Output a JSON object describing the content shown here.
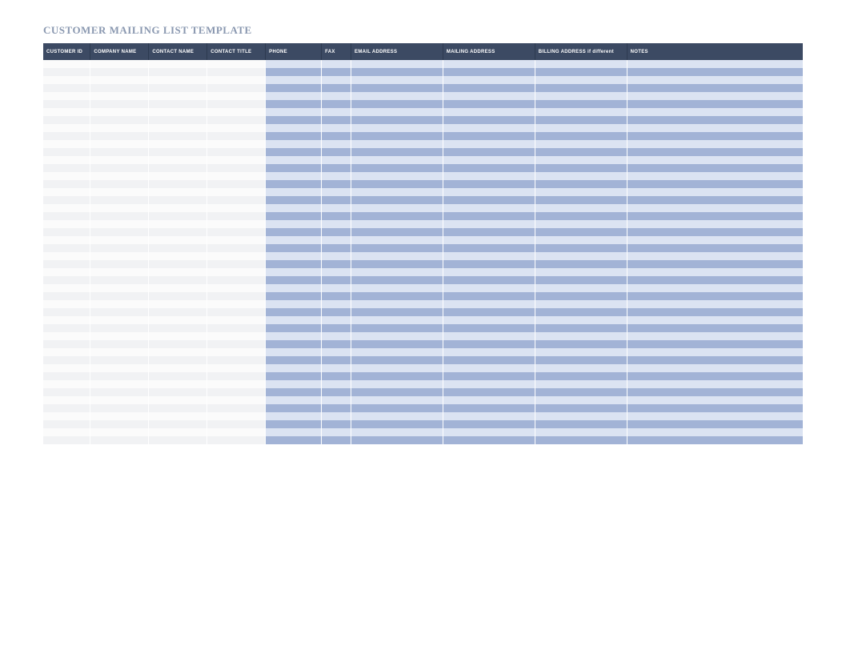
{
  "title": "CUSTOMER MAILING LIST TEMPLATE",
  "columns": [
    "CUSTOMER ID",
    "COMPANY NAME",
    "CONTACT NAME",
    "CONTACT TITLE",
    "PHONE",
    "FAX",
    "EMAIL ADDRESS",
    "MAILING ADDRESS",
    "BILLING ADDRESS if different",
    "NOTES"
  ],
  "row_count": 48,
  "light_columns": 4,
  "blue_columns": 6,
  "colors": {
    "title": "#8a98b0",
    "header_bg": "#3c4a63",
    "light_odd": "#fbfbfb",
    "light_even": "#f1f2f4",
    "blue_odd": "#dbe3f2",
    "blue_even": "#a2b3d6"
  }
}
